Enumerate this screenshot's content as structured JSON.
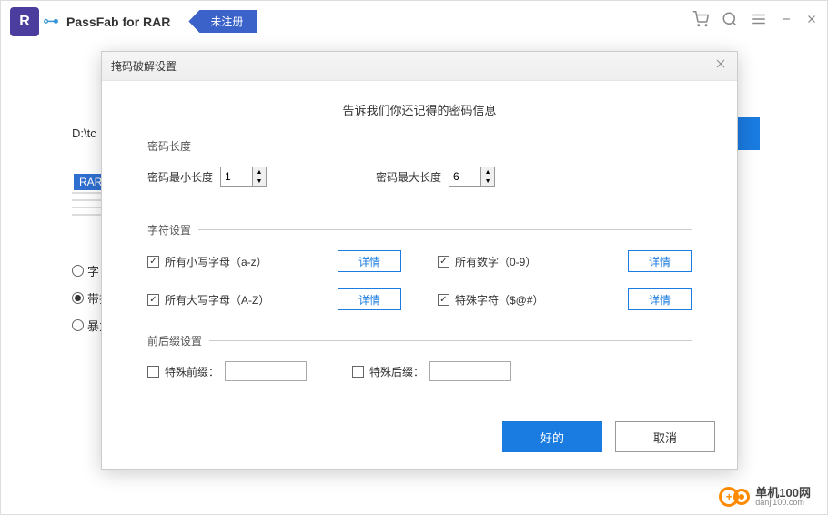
{
  "app": {
    "logo_letter": "R",
    "title": "PassFab for RAR",
    "unregistered": "未注册"
  },
  "background": {
    "path": "D:\\tc",
    "tab": "RAR",
    "radio1": "字",
    "radio2": "带排",
    "radio3": "暴力"
  },
  "dialog": {
    "title": "掩码破解设置",
    "subtitle": "告诉我们你还记得的密码信息",
    "length": {
      "legend": "密码长度",
      "min_label": "密码最小长度",
      "min_value": "1",
      "max_label": "密码最大长度",
      "max_value": "6"
    },
    "chars": {
      "legend": "字符设置",
      "lowercase": "所有小写字母（a-z）",
      "uppercase": "所有大写字母（A-Z）",
      "digits": "所有数字（0-9）",
      "special": "特殊字符（$@#）",
      "detail": "详情"
    },
    "affix": {
      "legend": "前后缀设置",
      "prefix": "特殊前缀：",
      "suffix": "特殊后缀："
    },
    "ok": "好的",
    "cancel": "取消"
  },
  "watermark": {
    "cn": "单机100网",
    "en": "danji100.com"
  }
}
